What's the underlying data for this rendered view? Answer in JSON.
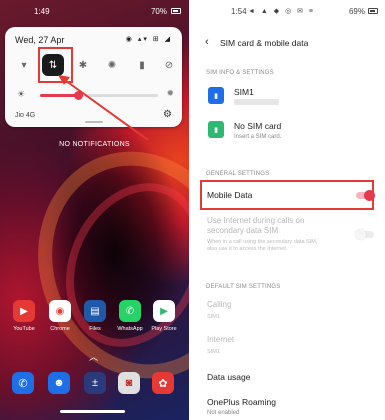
{
  "left": {
    "status_bar": {
      "time": "1:49",
      "battery": "70%"
    },
    "quick_settings": {
      "date": "Wed, 27 Apr",
      "system_icons": "◉ ▴▾ ⊞ ◢",
      "tiles": [
        {
          "name": "wifi",
          "glyph": "▾",
          "active": false
        },
        {
          "name": "mobile-data",
          "glyph": "⇅",
          "active": true
        },
        {
          "name": "bluetooth",
          "glyph": "✱",
          "active": false
        },
        {
          "name": "brightness-mode",
          "glyph": "✺",
          "active": false
        },
        {
          "name": "flashlight",
          "glyph": "▮",
          "active": false
        },
        {
          "name": "rotate",
          "glyph": "⊘",
          "active": false
        }
      ],
      "brightness_level": 0.32,
      "carrier": "Jio 4G"
    },
    "notifications_text": "NO NOTIFICATIONS",
    "apps": [
      {
        "label": "YouTube",
        "color": "#e53935",
        "glyph": "▶"
      },
      {
        "label": "Chrome",
        "color": "#ffffff",
        "glyph": "◉"
      },
      {
        "label": "Files",
        "color": "#1e5aa8",
        "glyph": "▤"
      },
      {
        "label": "WhatsApp",
        "color": "#25d366",
        "glyph": "✆"
      },
      {
        "label": "Play Store",
        "color": "#ffffff",
        "glyph": "▶"
      }
    ],
    "dock": [
      {
        "name": "phone",
        "color": "#1e6ee8",
        "glyph": "✆"
      },
      {
        "name": "contacts",
        "color": "#1e6ee8",
        "glyph": "☻"
      },
      {
        "name": "calculator",
        "color": "#2a3a7a",
        "glyph": "±"
      },
      {
        "name": "camera",
        "color": "#e0e0e0",
        "glyph": "◙"
      },
      {
        "name": "gallery",
        "color": "#e53935",
        "glyph": "✿"
      }
    ]
  },
  "right": {
    "status_bar": {
      "time": "1:54",
      "icons": "◄ ▲ ◆ ◎ ✉ ≡",
      "battery": "69%"
    },
    "header": {
      "back_icon": "‹",
      "title": "SIM card & mobile data"
    },
    "sim_info_header": "SIM INFO & SETTINGS",
    "sim1": {
      "title": "SIM1",
      "icon_color": "#1e6ee8"
    },
    "sim2": {
      "title": "No SIM card",
      "subtitle": "Insert a SIM card.",
      "icon_color": "#2eb872"
    },
    "general_header": "GENERAL SETTINGS",
    "mobile_data": {
      "label": "Mobile Data",
      "enabled": true
    },
    "secondary": {
      "title_line1": "Use Internet during calls on",
      "title_line2": "secondary data SIM",
      "sub_line1": "When in a call using the secondary data SIM,",
      "sub_line2": "also use it to access the Internet.",
      "enabled": false
    },
    "default_header": "DEFAULT SIM SETTINGS",
    "calling": {
      "title": "Calling",
      "value": "SIM1"
    },
    "internet": {
      "title": "Internet",
      "value": "SIM1"
    },
    "data_usage": "Data usage",
    "roaming": {
      "title": "OnePlus Roaming",
      "value": "Not enabled"
    }
  },
  "colors": {
    "accent": "#e53950",
    "highlight": "#e53935"
  }
}
